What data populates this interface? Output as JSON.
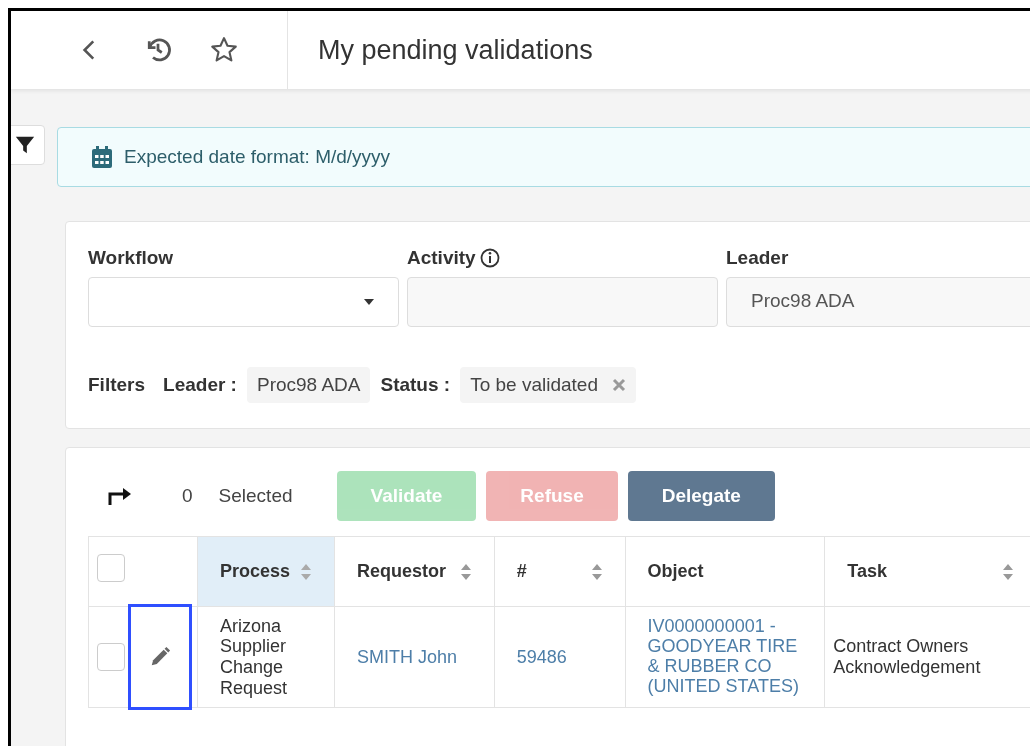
{
  "header": {
    "title": "My pending validations"
  },
  "info": {
    "text": "Expected date format: M/d/yyyy"
  },
  "form": {
    "fields": [
      {
        "label": "Workflow",
        "kind": "select",
        "info": false
      },
      {
        "label": "Activity",
        "kind": "text",
        "info": true
      },
      {
        "label": "Leader",
        "kind": "text",
        "value": "Proc98 ADA",
        "info": false
      }
    ]
  },
  "filters": {
    "label": "Filters",
    "chips": [
      {
        "label": "Leader :",
        "value": "Proc98 ADA",
        "removable": false
      },
      {
        "label": "Status :",
        "value": "To be validated",
        "removable": true
      }
    ]
  },
  "toolbar": {
    "count": "0",
    "count_label": "Selected",
    "buttons": [
      {
        "label": "Validate",
        "kind": "success",
        "disabled": true
      },
      {
        "label": "Refuse",
        "kind": "danger",
        "disabled": true
      },
      {
        "label": "Delegate",
        "kind": "secondary",
        "disabled": false
      }
    ]
  },
  "table": {
    "select_all_checked": false,
    "columns": [
      {
        "label": "Process",
        "sortable": true,
        "selected": true
      },
      {
        "label": "Requestor",
        "sortable": true,
        "selected": false
      },
      {
        "label": "#",
        "sortable": true,
        "selected": false
      },
      {
        "label": "Object",
        "sortable": false,
        "selected": false
      },
      {
        "label": "Task",
        "sortable": true,
        "selected": false
      }
    ],
    "rows": [
      {
        "checked": false,
        "highlighted": true,
        "process": "Arizona Supplier Change Request",
        "requestor": "SMITH John",
        "number": "59486",
        "object": "IV0000000001 - GOODYEAR TIRE & RUBBER CO (UNITED STATES)",
        "task": "Contract Owners Acknowledgement"
      }
    ]
  }
}
